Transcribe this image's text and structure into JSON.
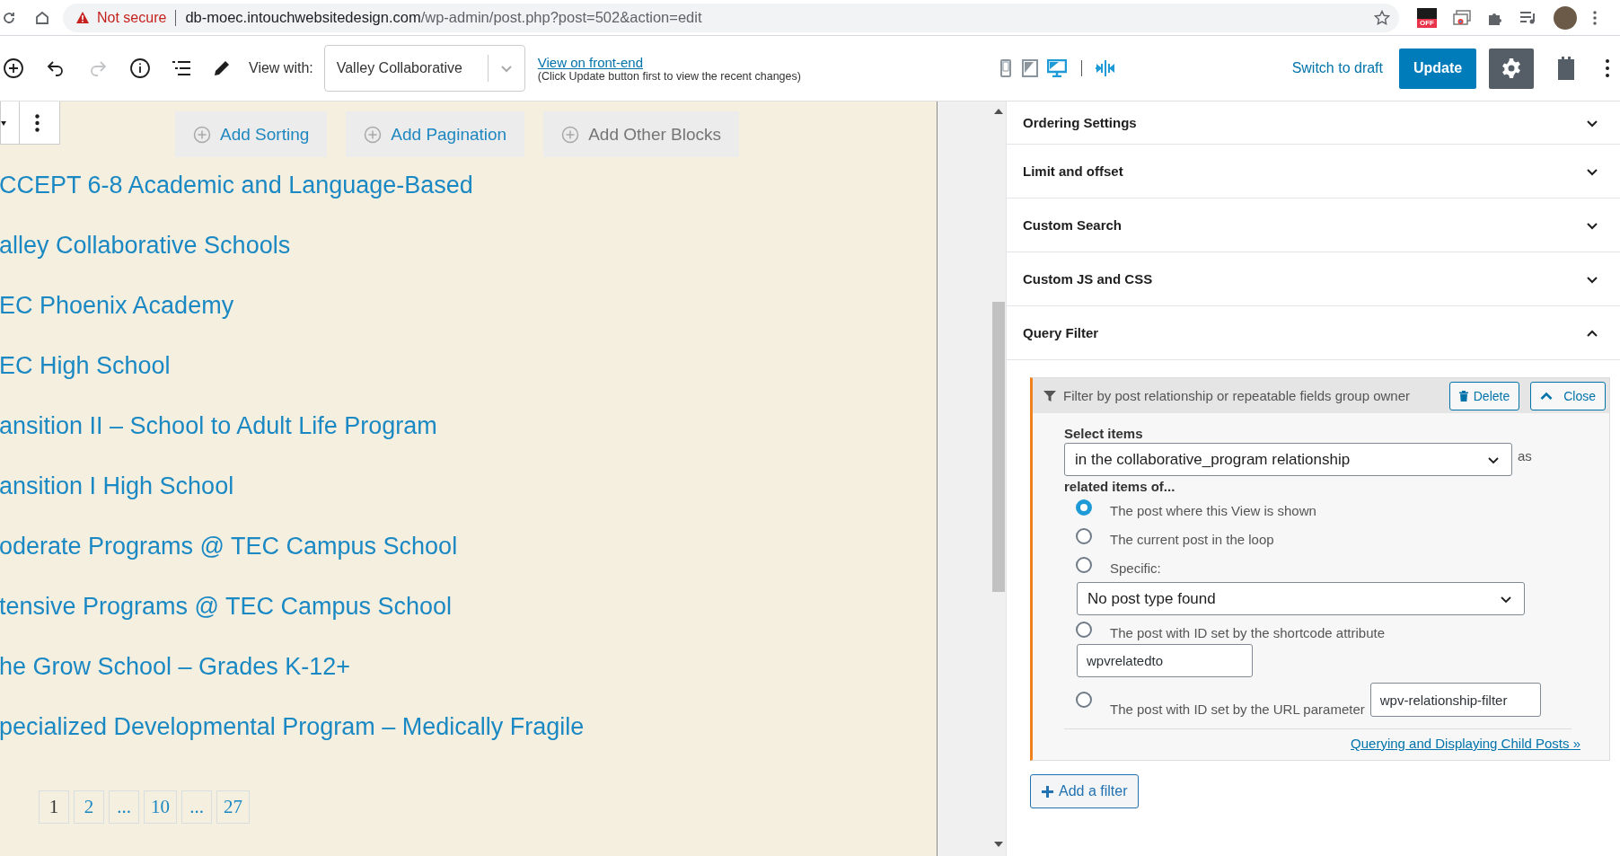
{
  "browser": {
    "security_label": "Not secure",
    "url_host": "db-moec.intouchwebsitedesign.com",
    "url_path": "/wp-admin/post.php?post=502&action=edit",
    "extension_badge": "OFF"
  },
  "toolbar": {
    "redo_disabled": true,
    "view_with_label": "View with:",
    "view_with_value": "Valley Collaborative",
    "front_end_link": "View on front-end",
    "front_end_hint": "(Click Update button first to view the recent changes)",
    "preview_modes": [
      {
        "kind": "mobile",
        "selected": false
      },
      {
        "kind": "tablet",
        "selected": false
      },
      {
        "kind": "desktop",
        "selected": true
      }
    ],
    "switch_to_draft": "Switch to draft",
    "update": "Update",
    "settings_selected": true
  },
  "canvas": {
    "add_buttons": [
      {
        "label": "Add Sorting",
        "disabled": false
      },
      {
        "label": "Add Pagination",
        "disabled": false
      },
      {
        "label": "Add Other Blocks",
        "disabled": true
      }
    ],
    "items": [
      "CCEPT 6-8 Academic and Language-Based",
      "alley Collaborative Schools",
      "EC Phoenix Academy",
      "EC High School",
      "ansition II – School to Adult Life Program",
      "ansition I High School",
      "oderate Programs @ TEC Campus School",
      "tensive Programs @ TEC Campus School",
      "he Grow School – Grades K-12+",
      "pecialized Developmental Program – Medically Fragile"
    ],
    "pagination": [
      {
        "label": "1",
        "selected": true
      },
      {
        "label": "2",
        "selected": false
      },
      {
        "label": "...",
        "selected": false
      },
      {
        "label": "10",
        "selected": false
      },
      {
        "label": "...",
        "selected": false
      },
      {
        "label": "27",
        "selected": false
      }
    ]
  },
  "sidebar": {
    "panels": [
      {
        "title": "Ordering Settings",
        "expanded": false
      },
      {
        "title": "Limit and offset",
        "expanded": false
      },
      {
        "title": "Custom Search",
        "expanded": false
      },
      {
        "title": "Custom JS and CSS",
        "expanded": false
      },
      {
        "title": "Query Filter",
        "expanded": true
      }
    ],
    "filter": {
      "title": "Filter by post relationship or repeatable fields group owner",
      "delete": "Delete",
      "close": "Close",
      "select_label": "Select items",
      "relationship": "in the collaborative_program relationship",
      "as_label": "as",
      "related_label": "related items of...",
      "options": [
        {
          "kind": "plain",
          "label": "The post where this View is shown",
          "selected": true
        },
        {
          "kind": "plain",
          "label": "The current post in the loop",
          "selected": false
        },
        {
          "kind": "select",
          "label": "Specific:",
          "selected": false,
          "value": "No post type found"
        },
        {
          "kind": "input-below",
          "label": "The post with ID set by the shortcode attribute",
          "selected": false,
          "value": "wpvrelatedto"
        },
        {
          "kind": "input-inline",
          "label": "The post with ID set by the URL parameter",
          "selected": false,
          "value": "wpv-relationship-filter"
        }
      ],
      "help_link": "Querying and Displaying Child Posts »"
    },
    "add_filter": "Add a filter"
  }
}
